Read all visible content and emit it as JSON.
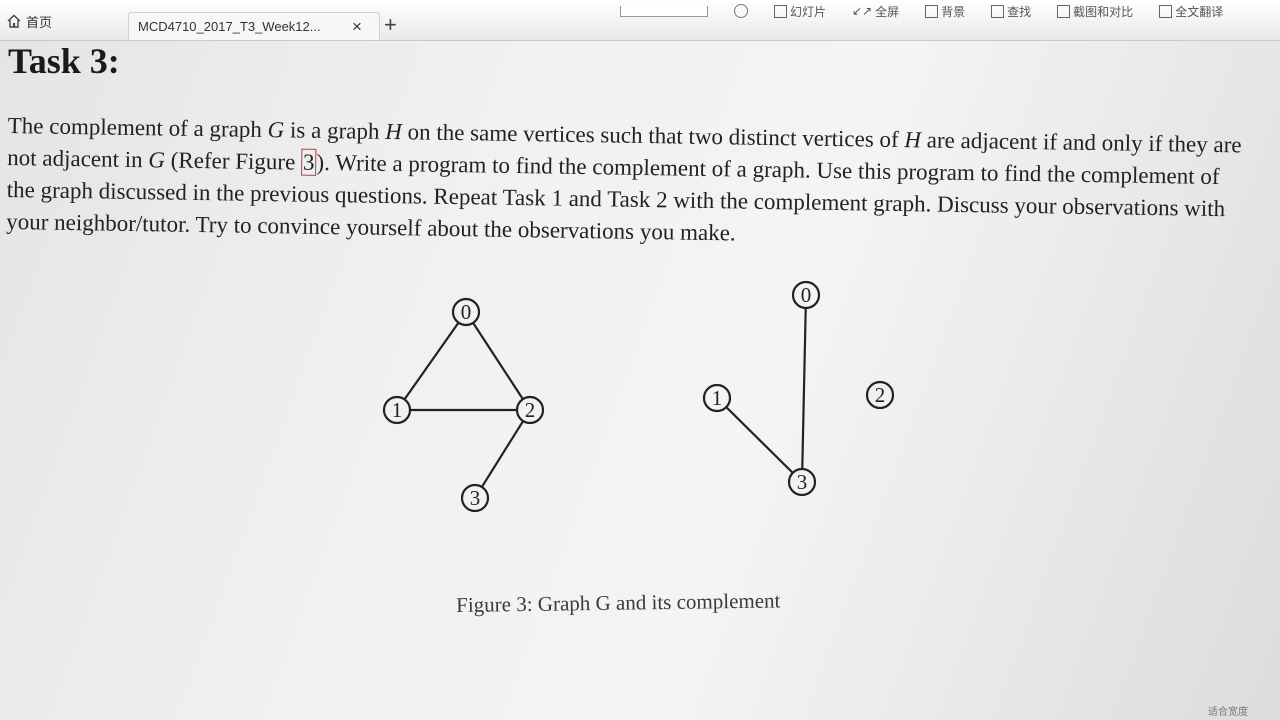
{
  "tabs": {
    "home_label": "首页",
    "doc_title": "MCD4710_2017_T3_Week12...",
    "close_symbol": "×",
    "new_tab_symbol": "+"
  },
  "toolbar": {
    "slideshow": "幻灯片",
    "fullscreen": "全屏",
    "background": "背景",
    "find": "查找",
    "compare": "截图和对比",
    "translate": "全文翻译"
  },
  "document": {
    "heading": "Task 3:",
    "paragraph": {
      "t1": "The complement of a graph ",
      "g1": "G",
      "t2": " is a graph ",
      "h1": "H",
      "t3": " on the same vertices such that two distinct vertices of ",
      "h2": "H",
      "t4": " are adjacent if and only if they are not adjacent in ",
      "g2": "G",
      "t5": " (Refer Figure ",
      "ref": "3",
      "t6": "). Write a program to find the complement of a graph. Use this program to find the complement of the graph discussed in the previous questions. Repeat Task 1 and Task 2 with the complement graph. Discuss your observations with your neighbor/tutor. Try to convince yourself about the observations you make."
    },
    "figure_caption": "Figure 3: Graph G and its complement",
    "graph_g": {
      "vertices": [
        "0",
        "1",
        "2",
        "3"
      ],
      "edges": [
        [
          "0",
          "1"
        ],
        [
          "0",
          "2"
        ],
        [
          "1",
          "2"
        ],
        [
          "2",
          "3"
        ]
      ]
    },
    "graph_complement": {
      "vertices": [
        "0",
        "1",
        "2",
        "3"
      ],
      "edges": [
        [
          "0",
          "3"
        ],
        [
          "1",
          "3"
        ]
      ]
    }
  },
  "status": {
    "fit_label": "适合宽度"
  }
}
